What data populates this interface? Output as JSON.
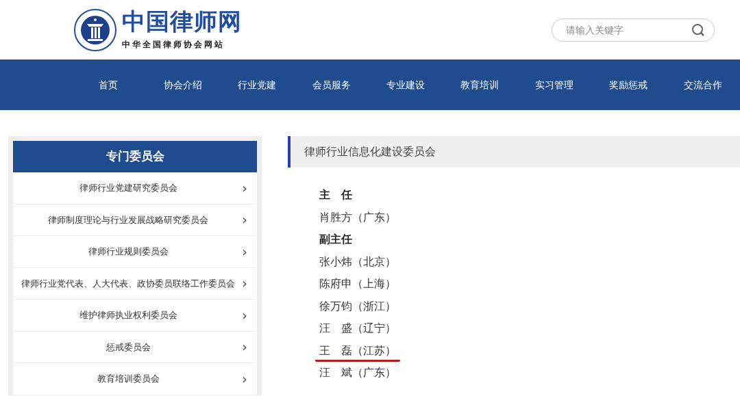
{
  "logo": {
    "title": "中国律师网",
    "subtitle": "中华全国律师协会网站"
  },
  "search": {
    "placeholder": "请输入关键字"
  },
  "nav": [
    "首页",
    "协会介绍",
    "行业党建",
    "会员服务",
    "专业建设",
    "教育培训",
    "实习管理",
    "奖励惩戒",
    "交流合作"
  ],
  "sidebar": {
    "title": "专门委员会",
    "items": [
      {
        "label": "律师行业党建研究委员会",
        "chevron": "›"
      },
      {
        "label": "律师制度理论与行业发展战略研究委员会",
        "chevron": "›"
      },
      {
        "label": "律师行业规则委员会",
        "chevron": "›"
      },
      {
        "label": "律师行业党代表、人大代表、政协委员联络工作委员会",
        "chevron": "›"
      },
      {
        "label": "维护律师执业权利委员会",
        "chevron": "›"
      },
      {
        "label": "惩戒委员会",
        "chevron": "›"
      },
      {
        "label": "教育培训委员会",
        "chevron": "›"
      }
    ]
  },
  "content": {
    "title": "律师行业信息化建设委员会",
    "members": [
      {
        "kind": "heading",
        "text": "主　任",
        "underlined": false
      },
      {
        "kind": "member",
        "text": "肖胜方（广东）",
        "underlined": false
      },
      {
        "kind": "heading",
        "text": "副主任",
        "underlined": false
      },
      {
        "kind": "member",
        "text": "张小炜（北京）",
        "underlined": false
      },
      {
        "kind": "member",
        "text": "陈府申（上海）",
        "underlined": false
      },
      {
        "kind": "member",
        "text": "徐万钧（浙江）",
        "underlined": false
      },
      {
        "kind": "member",
        "text": "汪　盛（辽宁）",
        "underlined": false
      },
      {
        "kind": "member",
        "text": "王　磊（江苏）",
        "underlined": true
      },
      {
        "kind": "member",
        "text": "汪　斌（广东）",
        "underlined": false
      }
    ]
  }
}
